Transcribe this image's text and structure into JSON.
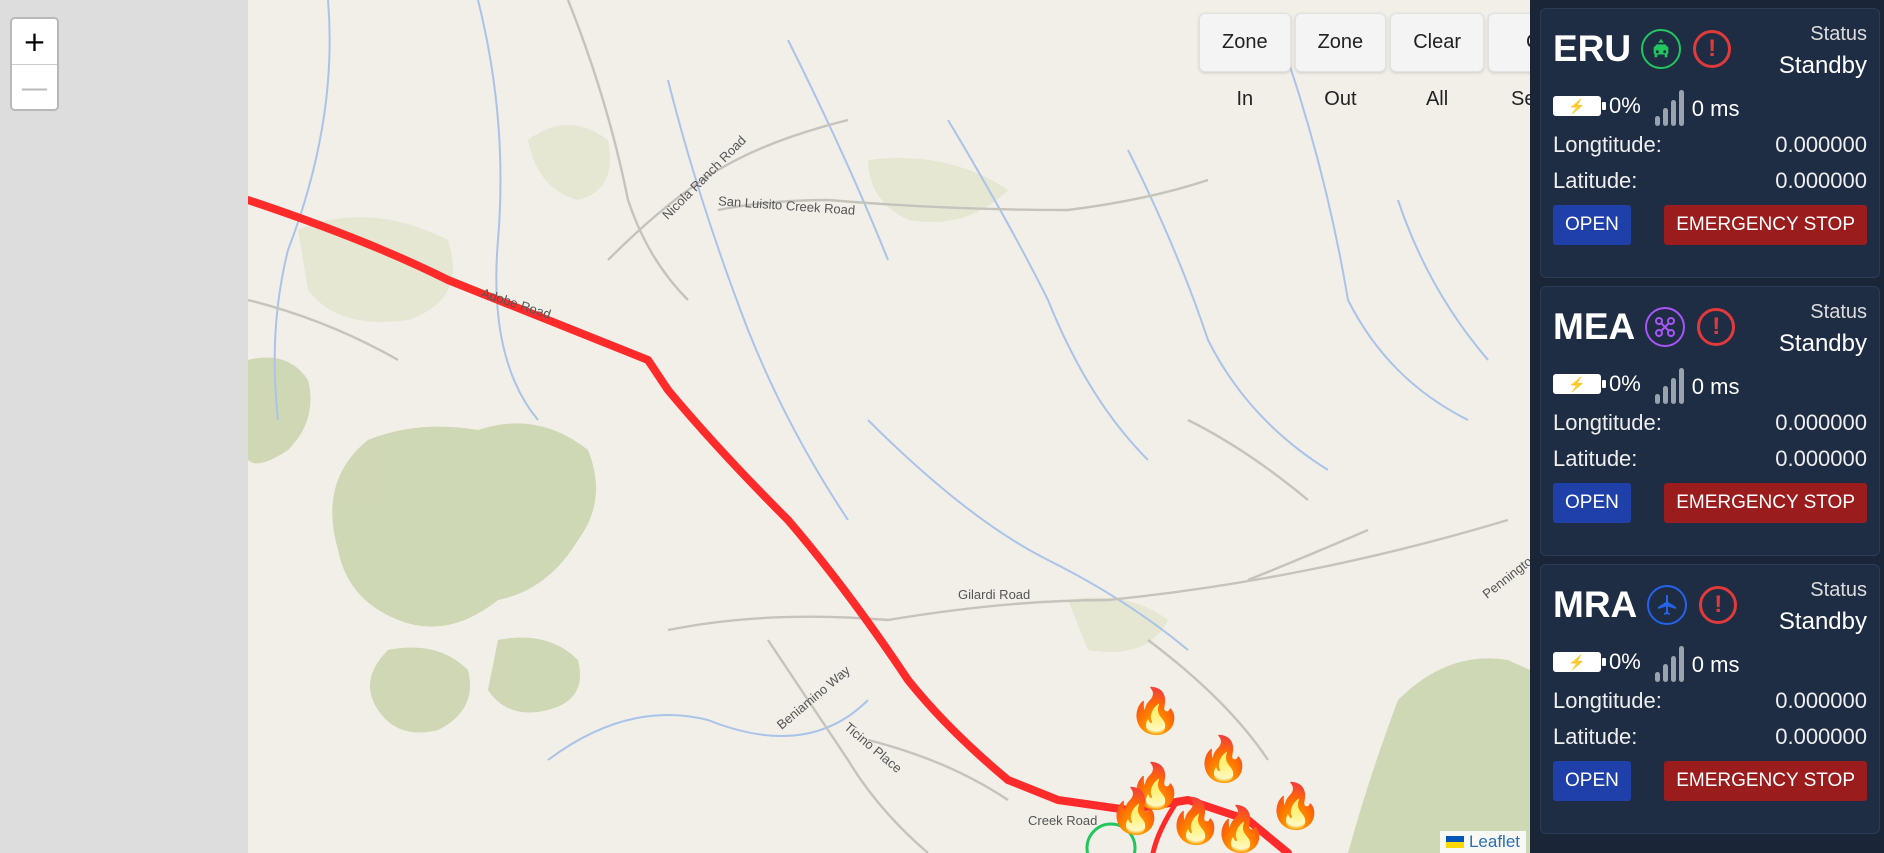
{
  "zoom": {
    "in_label": "+",
    "out_label": "—"
  },
  "toolbar": {
    "zone_in": "Zone In",
    "zone_out": "Zone Out",
    "clear_all": "Clear All",
    "clear_selected": "Clear Selected"
  },
  "map": {
    "attribution": "Leaflet",
    "route_color": "#ff2a2a",
    "labels": {
      "nicola_ranch": "Nicola Ranch Road",
      "san_luisito": "San Luisito Creek Road",
      "adobe": "Adobe Road",
      "gilardi": "Gilardi Road",
      "beniamino": "Beniamino Way",
      "ticino": "Ticino Place",
      "pennington": "Penningto",
      "creek_road": "Creek Road"
    }
  },
  "units": [
    {
      "name": "ERU",
      "icon": "car-icon",
      "icon_color": "#22c55e",
      "status_label": "Status",
      "status": "Standby",
      "battery": "0%",
      "latency": "0 ms",
      "longitude_label": "Longtitude:",
      "longitude": "0.000000",
      "latitude_label": "Latitude:",
      "latitude": "0.000000",
      "open_label": "OPEN",
      "stop_label": "EMERGENCY STOP"
    },
    {
      "name": "MEA",
      "icon": "drone-icon",
      "icon_color": "#a855f7",
      "status_label": "Status",
      "status": "Standby",
      "battery": "0%",
      "latency": "0 ms",
      "longitude_label": "Longtitude:",
      "longitude": "0.000000",
      "latitude_label": "Latitude:",
      "latitude": "0.000000",
      "open_label": "OPEN",
      "stop_label": "EMERGENCY STOP"
    },
    {
      "name": "MRA",
      "icon": "airplane-icon",
      "icon_color": "#2563eb",
      "status_label": "Status",
      "status": "Standby",
      "battery": "0%",
      "latency": "0 ms",
      "longitude_label": "Longtitude:",
      "longitude": "0.000000",
      "latitude_label": "Latitude:",
      "latitude": "0.000000",
      "open_label": "OPEN",
      "stop_label": "EMERGENCY STOP"
    }
  ]
}
